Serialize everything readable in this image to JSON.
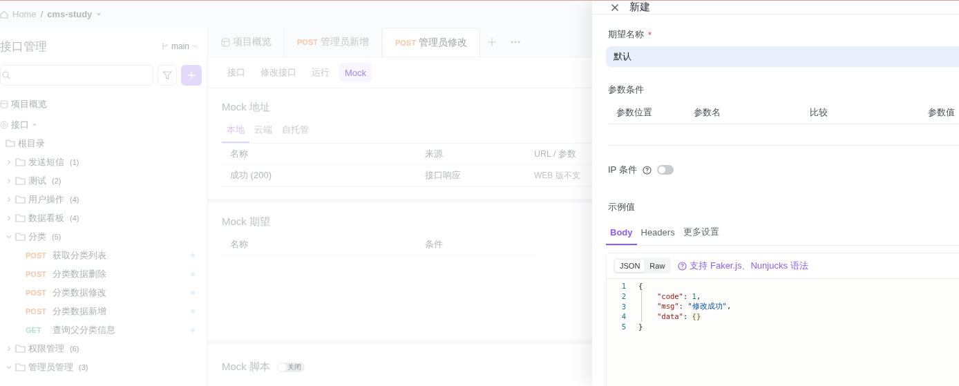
{
  "breadcrumb": {
    "home": "Home",
    "separator": "/",
    "project": "cms-study"
  },
  "sidebar": {
    "title": "接口管理",
    "branch": "main",
    "overview": {
      "label": "项目概览"
    },
    "interfaces": {
      "label": "接口",
      "expanded": true,
      "root": "根目录",
      "children": [
        {
          "kind": "folder",
          "label": "发送短信",
          "count": "(1)",
          "expanded": false
        },
        {
          "kind": "folder",
          "label": "测试",
          "count": "(2)",
          "expanded": false
        },
        {
          "kind": "folder",
          "label": "用户操作",
          "count": "(4)",
          "expanded": false
        },
        {
          "kind": "folder",
          "label": "数据看板",
          "count": "(4)",
          "expanded": false
        },
        {
          "kind": "folder",
          "label": "分类",
          "count": "(5)",
          "expanded": true,
          "children": [
            {
              "kind": "endpoint",
              "method": "POST",
              "label": "获取分类列表"
            },
            {
              "kind": "endpoint",
              "method": "POST",
              "label": "分类数据删除"
            },
            {
              "kind": "endpoint",
              "method": "POST",
              "label": "分类数据修改"
            },
            {
              "kind": "endpoint",
              "method": "POST",
              "label": "分类数据新增"
            },
            {
              "kind": "endpoint",
              "method": "GET",
              "label": "查询父分类信息"
            }
          ]
        },
        {
          "kind": "folder",
          "label": "权限管理",
          "count": "(6)",
          "expanded": false
        },
        {
          "kind": "folder",
          "label": "管理员管理",
          "count": "(3)",
          "expanded": true
        }
      ]
    }
  },
  "main": {
    "tabs": [
      {
        "kind": "overview",
        "label": "项目概览",
        "selected": false
      },
      {
        "kind": "request",
        "method": "POST",
        "label": "管理员新增",
        "selected": false
      },
      {
        "kind": "request",
        "method": "POST",
        "label": "管理员修改",
        "selected": true
      }
    ],
    "subtabs": [
      {
        "label": "接口",
        "selected": false
      },
      {
        "label": "修改接口",
        "selected": false
      },
      {
        "label": "运行",
        "selected": false
      },
      {
        "label": "Mock",
        "selected": true
      }
    ],
    "mock_address": {
      "title": "Mock 地址",
      "tabs": [
        {
          "label": "本地",
          "selected": true
        },
        {
          "label": "云端",
          "selected": false
        },
        {
          "label": "自托管",
          "selected": false
        }
      ],
      "columns": [
        "名称",
        "来源",
        "URL / 参数"
      ],
      "rows": [
        {
          "cells": [
            "成功 (200)",
            "接口响应",
            "WEB 版不支"
          ]
        }
      ]
    },
    "mock_expectations": {
      "title": "Mock 期望",
      "columns": [
        "名称",
        "条件"
      ]
    },
    "mock_script": {
      "title": "Mock 脚本",
      "enabled": false,
      "toggle_label": "关闭"
    }
  },
  "drawer": {
    "title": "新建",
    "name_field": {
      "label": "期望名称",
      "required_mark": "*",
      "value": "默认"
    },
    "param_conditions": {
      "title": "参数条件",
      "columns": [
        "参数位置",
        "参数名",
        "比较",
        "参数值"
      ]
    },
    "ip_condition": {
      "label": "IP 条件",
      "enabled": false
    },
    "example": {
      "title": "示例值",
      "tabs": [
        {
          "label": "Body",
          "selected": true
        },
        {
          "label": "Headers",
          "selected": false
        },
        {
          "label": "更多设置",
          "selected": false
        }
      ],
      "formats": [
        {
          "label": "JSON",
          "selected": true
        },
        {
          "label": "Raw",
          "selected": false
        }
      ],
      "syntax_hint": "支持 Faker.js、Nunjucks 语法",
      "code": [
        {
          "no": "1",
          "indented": false,
          "tokens": [
            {
              "t": "{",
              "kind": "punct"
            }
          ]
        },
        {
          "no": "2",
          "indented": true,
          "tokens": [
            {
              "t": "\"code\"",
              "kind": "key"
            },
            {
              "t": ": ",
              "kind": "punct"
            },
            {
              "t": "1",
              "kind": "number"
            },
            {
              "t": ",",
              "kind": "punct"
            }
          ]
        },
        {
          "no": "3",
          "indented": true,
          "tokens": [
            {
              "t": "\"msg\"",
              "kind": "key"
            },
            {
              "t": ": ",
              "kind": "punct"
            },
            {
              "t": "\"修改成功\"",
              "kind": "string"
            },
            {
              "t": ",",
              "kind": "punct"
            }
          ]
        },
        {
          "no": "4",
          "indented": true,
          "tokens": [
            {
              "t": "\"data\"",
              "kind": "key"
            },
            {
              "t": ": ",
              "kind": "punct"
            },
            {
              "t": "{}",
              "kind": "brace"
            }
          ]
        },
        {
          "no": "5",
          "indented": false,
          "tokens": [
            {
              "t": "}",
              "kind": "punct"
            }
          ]
        }
      ]
    }
  }
}
